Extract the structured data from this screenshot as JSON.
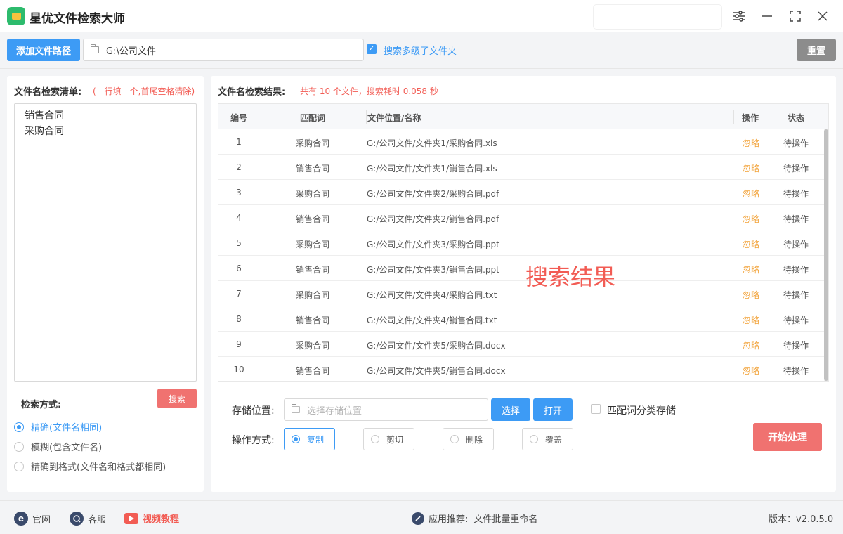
{
  "app": {
    "title": "星优文件检索大师"
  },
  "toolbar": {
    "add_path_label": "添加文件路径",
    "path_value": "G:\\公司文件",
    "subfolder_label": "搜索多级子文件夹",
    "subfolder_checked": true,
    "reset_label": "重置"
  },
  "left": {
    "list_label": "文件名检索清单:",
    "list_hint": "(一行填一个,首尾空格清除)",
    "keywords": [
      "销售合同",
      "采购合同"
    ],
    "mode_label": "检索方式:",
    "search_label": "搜索",
    "modes": [
      {
        "label": "精确(文件名相同)",
        "selected": true
      },
      {
        "label": "模糊(包含文件名)",
        "selected": false
      },
      {
        "label": "精确到格式(文件名和格式都相同)",
        "selected": false
      }
    ]
  },
  "results": {
    "label": "文件名检索结果:",
    "summary": "共有 10 个文件，搜索耗时 0.058 秒",
    "columns": [
      "编号",
      "匹配词",
      "文件位置/名称",
      "操作",
      "状态"
    ],
    "rows": [
      {
        "no": "1",
        "kw": "采购合同",
        "path": "G:/公司文件/文件夹1/采购合同.xls",
        "action": "忽略",
        "status": "待操作"
      },
      {
        "no": "2",
        "kw": "销售合同",
        "path": "G:/公司文件/文件夹1/销售合同.xls",
        "action": "忽略",
        "status": "待操作"
      },
      {
        "no": "3",
        "kw": "采购合同",
        "path": "G:/公司文件/文件夹2/采购合同.pdf",
        "action": "忽略",
        "status": "待操作"
      },
      {
        "no": "4",
        "kw": "销售合同",
        "path": "G:/公司文件/文件夹2/销售合同.pdf",
        "action": "忽略",
        "status": "待操作"
      },
      {
        "no": "5",
        "kw": "采购合同",
        "path": "G:/公司文件/文件夹3/采购合同.ppt",
        "action": "忽略",
        "status": "待操作"
      },
      {
        "no": "6",
        "kw": "销售合同",
        "path": "G:/公司文件/文件夹3/销售合同.ppt",
        "action": "忽略",
        "status": "待操作"
      },
      {
        "no": "7",
        "kw": "采购合同",
        "path": "G:/公司文件/文件夹4/采购合同.txt",
        "action": "忽略",
        "status": "待操作"
      },
      {
        "no": "8",
        "kw": "销售合同",
        "path": "G:/公司文件/文件夹4/销售合同.txt",
        "action": "忽略",
        "status": "待操作"
      },
      {
        "no": "9",
        "kw": "采购合同",
        "path": "G:/公司文件/文件夹5/采购合同.docx",
        "action": "忽略",
        "status": "待操作"
      },
      {
        "no": "10",
        "kw": "销售合同",
        "path": "G:/公司文件/文件夹5/销售合同.docx",
        "action": "忽略",
        "status": "待操作"
      }
    ],
    "watermark": "搜索结果"
  },
  "bottom": {
    "save_label": "存储位置:",
    "save_placeholder": "选择存储位置",
    "choose_label": "选择",
    "open_label": "打开",
    "classify_label": "匹配词分类存储",
    "classify_checked": false,
    "op_label": "操作方式:",
    "ops": [
      {
        "label": "复制",
        "selected": true
      },
      {
        "label": "剪切",
        "selected": false
      },
      {
        "label": "删除",
        "selected": false
      },
      {
        "label": "覆盖",
        "selected": false
      }
    ],
    "start_label": "开始处理"
  },
  "footer": {
    "website": "官网",
    "service": "客服",
    "video": "视频教程",
    "recommend_prefix": "应用推荐:",
    "recommend_app": "文件批量重命名",
    "version": "版本：v2.0.5.0"
  },
  "colors": {
    "primary": "#3d9bf5",
    "danger": "#f07270",
    "warn": "#f2a33a",
    "reset": "#8c8c8c"
  },
  "icons": [
    "app-logo-icon",
    "settings-icon",
    "minimize-icon",
    "maximize-icon",
    "close-icon",
    "folder-icon",
    "checkbox-icon",
    "website-icon",
    "service-icon",
    "video-icon",
    "link-icon"
  ]
}
